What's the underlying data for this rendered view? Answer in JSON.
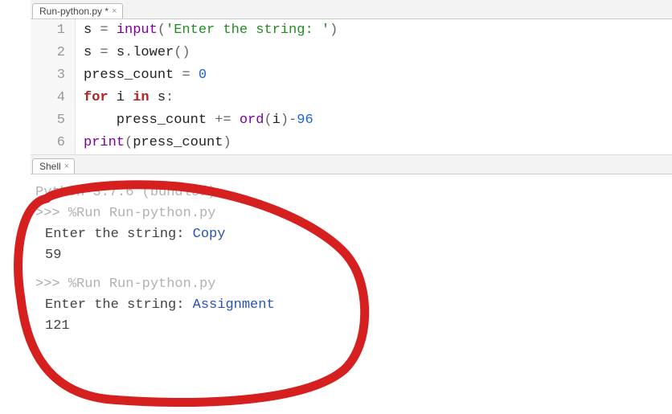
{
  "editor": {
    "tab": {
      "filename": "Run-python.py *",
      "close": "×"
    },
    "lines": [
      {
        "num": "1",
        "tokens": [
          {
            "t": "s",
            "c": "ident"
          },
          {
            "t": " ",
            "c": ""
          },
          {
            "t": "=",
            "c": "op"
          },
          {
            "t": " ",
            "c": ""
          },
          {
            "t": "input",
            "c": "func"
          },
          {
            "t": "(",
            "c": "op"
          },
          {
            "t": "'Enter the string: '",
            "c": "string"
          },
          {
            "t": ")",
            "c": "op"
          }
        ]
      },
      {
        "num": "2",
        "tokens": [
          {
            "t": "s",
            "c": "ident"
          },
          {
            "t": " ",
            "c": ""
          },
          {
            "t": "=",
            "c": "op"
          },
          {
            "t": " ",
            "c": ""
          },
          {
            "t": "s",
            "c": "ident"
          },
          {
            "t": ".",
            "c": "op"
          },
          {
            "t": "lower",
            "c": "ident"
          },
          {
            "t": "()",
            "c": "op"
          }
        ]
      },
      {
        "num": "3",
        "tokens": [
          {
            "t": "press_count",
            "c": "ident"
          },
          {
            "t": " ",
            "c": ""
          },
          {
            "t": "=",
            "c": "op"
          },
          {
            "t": " ",
            "c": ""
          },
          {
            "t": "0",
            "c": "number"
          }
        ]
      },
      {
        "num": "4",
        "tokens": [
          {
            "t": "for",
            "c": "keyword"
          },
          {
            "t": " i ",
            "c": "ident"
          },
          {
            "t": "in",
            "c": "keyword"
          },
          {
            "t": " s",
            "c": "ident"
          },
          {
            "t": ":",
            "c": "op"
          }
        ]
      },
      {
        "num": "5",
        "tokens": [
          {
            "t": "    press_count",
            "c": "ident"
          },
          {
            "t": " ",
            "c": ""
          },
          {
            "t": "+=",
            "c": "op"
          },
          {
            "t": " ",
            "c": ""
          },
          {
            "t": "ord",
            "c": "func"
          },
          {
            "t": "(",
            "c": "op"
          },
          {
            "t": "i",
            "c": "ident"
          },
          {
            "t": ")",
            "c": "op"
          },
          {
            "t": "-",
            "c": "op"
          },
          {
            "t": "96",
            "c": "number"
          }
        ]
      },
      {
        "num": "6",
        "tokens": [
          {
            "t": "print",
            "c": "func"
          },
          {
            "t": "(",
            "c": "op"
          },
          {
            "t": "press_count",
            "c": "ident"
          },
          {
            "t": ")",
            "c": "op"
          }
        ]
      }
    ]
  },
  "shell": {
    "tab": {
      "label": "Shell",
      "close": "×"
    },
    "version": "Python 3.7.6 (bundled)",
    "runs": [
      {
        "prompt": ">>> ",
        "cmd": "%Run Run-python.py",
        "prompt_text": "Enter the string: ",
        "input": "Copy",
        "output": "59"
      },
      {
        "prompt": ">>> ",
        "cmd": "%Run Run-python.py",
        "prompt_text": "Enter the string: ",
        "input": "Assignment",
        "output": "121"
      }
    ]
  }
}
